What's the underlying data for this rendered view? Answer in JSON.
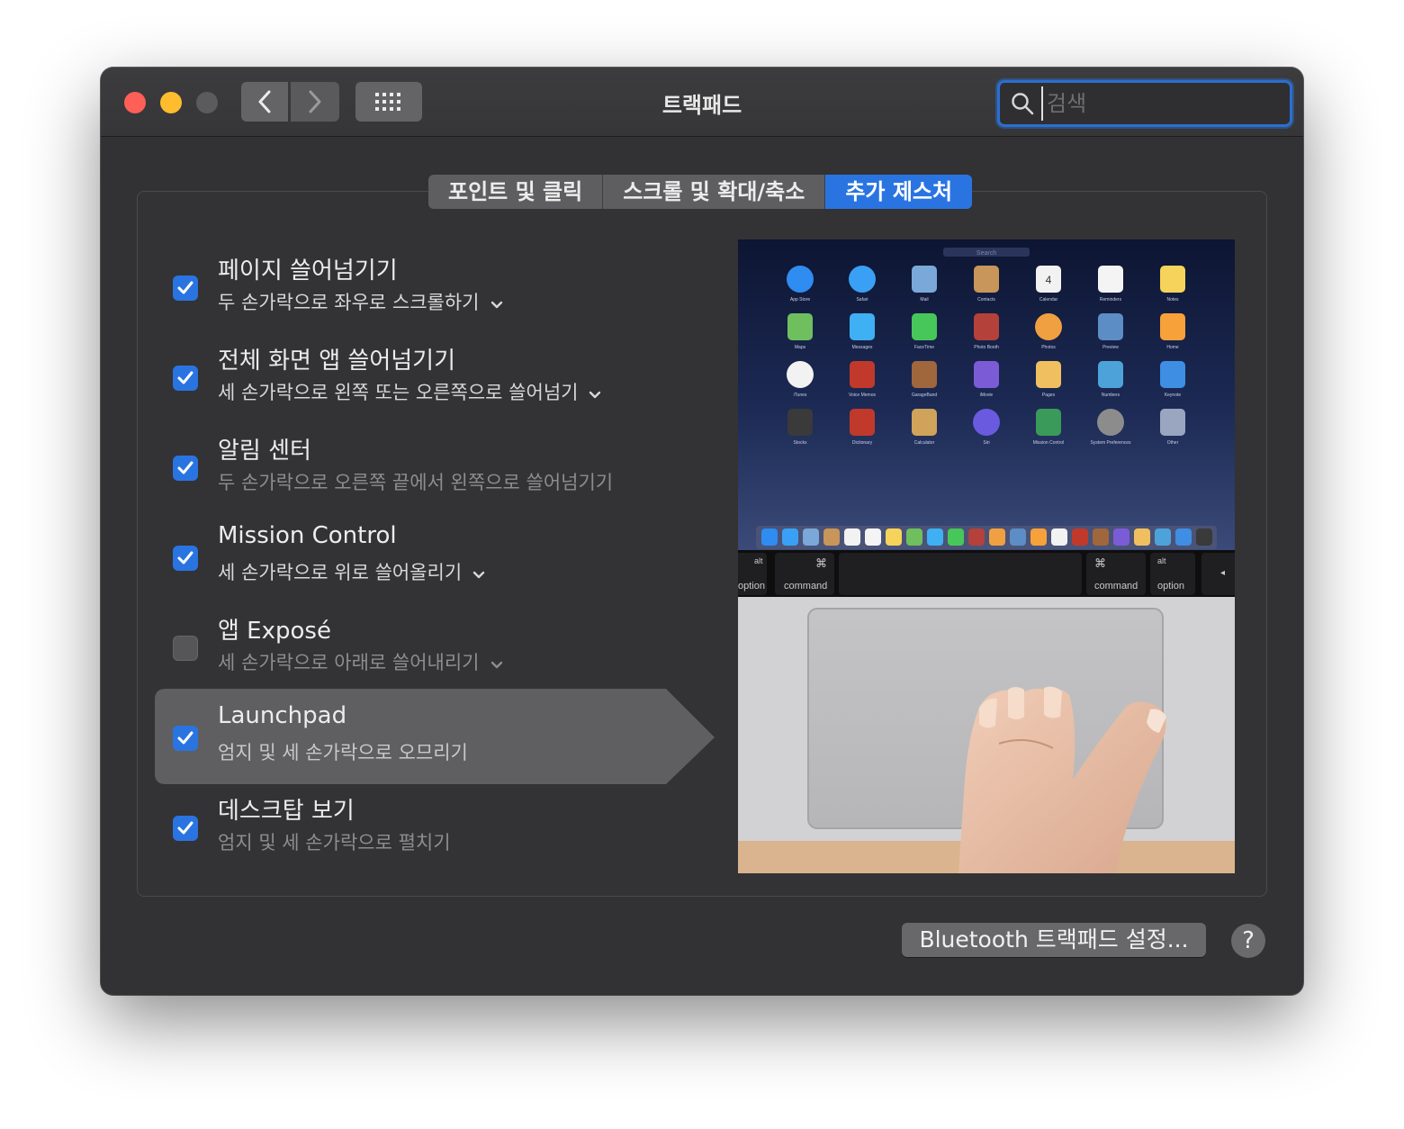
{
  "window": {
    "title": "트랙패드"
  },
  "search": {
    "placeholder": "검색",
    "value": ""
  },
  "tabs": [
    {
      "label": "포인트 및 클릭"
    },
    {
      "label": "스크롤 및 확대/축소"
    },
    {
      "label": "추가 제스처",
      "active": true
    }
  ],
  "gestures": [
    {
      "title": "페이지 쓸어넘기기",
      "subtitle": "두 손가락으로 좌우로 스크롤하기",
      "checked": true,
      "has_menu": true
    },
    {
      "title": "전체 화면 앱 쓸어넘기기",
      "subtitle": "세 손가락으로 왼쪽 또는 오른쪽으로 쓸어넘기",
      "checked": true,
      "has_menu": true
    },
    {
      "title": "알림 센터",
      "subtitle": "두 손가락으로 오른쪽 끝에서 왼쪽으로 쓸어넘기기",
      "checked": true,
      "has_menu": false
    },
    {
      "title": "Mission Control",
      "subtitle": "세 손가락으로 위로 쓸어올리기",
      "checked": true,
      "has_menu": true
    },
    {
      "title": "앱 Exposé",
      "subtitle": "세 손가락으로 아래로 쓸어내리기",
      "checked": false,
      "has_menu": true
    },
    {
      "title": "Launchpad",
      "subtitle": "엄지 및 세 손가락으로 오므리기",
      "checked": true,
      "has_menu": false,
      "selected": true
    },
    {
      "title": "데스크탑 보기",
      "subtitle": "엄지 및 세 손가락으로 펼치기",
      "checked": true,
      "has_menu": false
    }
  ],
  "preview": {
    "search_text": "Search",
    "apps": [
      "App Store",
      "Safari",
      "Mail",
      "Contacts",
      "Calendar",
      "Reminders",
      "Notes",
      "Maps",
      "Messages",
      "FaceTime",
      "Photo Booth",
      "Photos",
      "Preview",
      "Home",
      "iTunes",
      "Voice Memos",
      "GarageBand",
      "iMovie",
      "Pages",
      "Numbers",
      "Keynote",
      "Stocks",
      "Dictionary",
      "Calculator",
      "Siri",
      "Mission Control",
      "System Preferences",
      "Other"
    ],
    "calendar_day": "4",
    "keys": {
      "left_alt": "alt",
      "left_option": "option",
      "left_cmd_symbol": "⌘",
      "left_command": "command",
      "right_cmd_symbol": "⌘",
      "right_command": "command",
      "right_alt": "alt",
      "right_option": "option",
      "arrow": "◂"
    }
  },
  "buttons": {
    "bluetooth": "Bluetooth 트랙패드 설정...",
    "help": "?"
  },
  "colors": {
    "accent": "#2a74e2",
    "window_bg": "#323234",
    "close": "#fe5f57",
    "minimize": "#febc2e"
  }
}
